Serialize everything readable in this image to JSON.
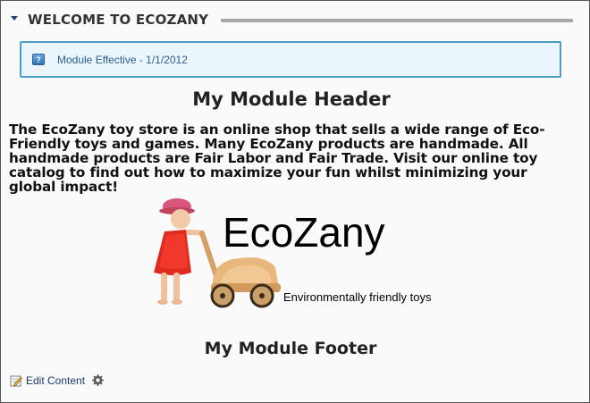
{
  "module": {
    "title": "WELCOME TO ECOZANY",
    "collapse_icon": "collapse-triangle-icon"
  },
  "info": {
    "icon": "info-icon",
    "icon_glyph": "?",
    "text": "Module Effective - 1/1/2012"
  },
  "content": {
    "header": "My Module Header",
    "description": "The EcoZany toy store is an online shop that sells a wide range of Eco-Friendly toys and games.  Many EcoZany products are handmade. All handmade products are Fair Labor and Fair Trade. Visit our online toy catalog to find out how to maximize your fun whilst minimizing your global impact!",
    "brand": "EcoZany",
    "tagline": "Environmentally friendly toys",
    "footer": "My Module Footer"
  },
  "actions": {
    "edit_label": "Edit Content",
    "edit_icon": "pencil-edit-icon",
    "settings_icon": "gear-icon"
  },
  "colors": {
    "info_border": "#4a9ec4",
    "info_background": "#eaf6fb",
    "link": "#1b3a6b"
  }
}
